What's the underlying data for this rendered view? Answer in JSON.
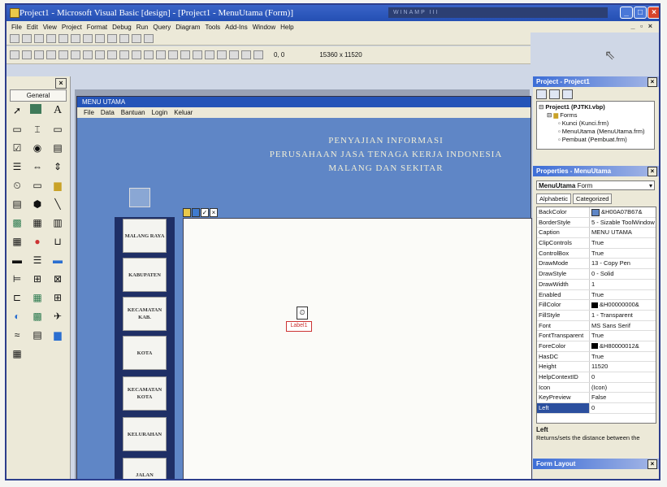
{
  "window": {
    "title": "Project1 - Microsoft Visual Basic [design] - [Project1 - MenuUtama (Form)]",
    "taskbar_text": "WINAMP III"
  },
  "menubar": [
    "File",
    "Edit",
    "View",
    "Project",
    "Format",
    "Debug",
    "Run",
    "Query",
    "Diagram",
    "Tools",
    "Add-Ins",
    "Window",
    "Help"
  ],
  "toolbar": {
    "position": "0, 0",
    "size": "15360 x 11520"
  },
  "toolbox": {
    "tab": "General"
  },
  "form": {
    "title": "MENU UTAMA",
    "menu": [
      "File",
      "Data",
      "Bantuan",
      "Login",
      "Keluar"
    ],
    "heading": [
      "PENYAJIAN INFORMASI",
      "PERUSAHAAN JASA TENAGA KERJA INDONESIA",
      "MALANG DAN SEKITAR"
    ],
    "buttons": [
      {
        "label": "MALANG RAYA"
      },
      {
        "label": "KABUPATEN"
      },
      {
        "label": "KECAMATAN KAB."
      },
      {
        "label": "KOTA"
      },
      {
        "label": "KECAMATAN KOTA"
      },
      {
        "label": "KELURAHAN"
      },
      {
        "label": "JALAN"
      }
    ],
    "label_control": "Label1"
  },
  "project_explorer": {
    "title": "Project - Project1",
    "root": "Project1 (PJTKI.vbp)",
    "folder": "Forms",
    "items": [
      "Kunci (Kunci.frm)",
      "MenuUtama (MenuUtama.frm)",
      "Pembuat (Pembuat.frm)"
    ]
  },
  "properties": {
    "title": "Properties - MenuUtama",
    "object": "MenuUtama",
    "object_type": "Form",
    "tabs": [
      "Alphabetic",
      "Categorized"
    ],
    "rows": [
      {
        "name": "BackColor",
        "value": "&H00A07B67&",
        "color": "#5f86c6"
      },
      {
        "name": "BorderStyle",
        "value": "5 - Sizable ToolWindow"
      },
      {
        "name": "Caption",
        "value": "MENU UTAMA"
      },
      {
        "name": "ClipControls",
        "value": "True"
      },
      {
        "name": "ControlBox",
        "value": "True"
      },
      {
        "name": "DrawMode",
        "value": "13 - Copy Pen"
      },
      {
        "name": "DrawStyle",
        "value": "0 - Solid"
      },
      {
        "name": "DrawWidth",
        "value": "1"
      },
      {
        "name": "Enabled",
        "value": "True"
      },
      {
        "name": "FillColor",
        "value": "&H00000000&",
        "color": "#000000"
      },
      {
        "name": "FillStyle",
        "value": "1 - Transparent"
      },
      {
        "name": "Font",
        "value": "MS Sans Serif"
      },
      {
        "name": "FontTransparent",
        "value": "True"
      },
      {
        "name": "ForeColor",
        "value": "&H80000012&",
        "color": "#000000"
      },
      {
        "name": "HasDC",
        "value": "True"
      },
      {
        "name": "Height",
        "value": "11520"
      },
      {
        "name": "HelpContextID",
        "value": "0"
      },
      {
        "name": "Icon",
        "value": "(Icon)"
      },
      {
        "name": "KeyPreview",
        "value": "False"
      },
      {
        "name": "Left",
        "value": "0"
      }
    ],
    "desc_title": "Left",
    "desc_text": "Returns/sets the distance between the"
  },
  "form_layout": {
    "title": "Form Layout"
  },
  "colors": {
    "titlebar": "#244fb3",
    "form_bg": "#5f86c6",
    "side_panel": "#1f2f66"
  }
}
